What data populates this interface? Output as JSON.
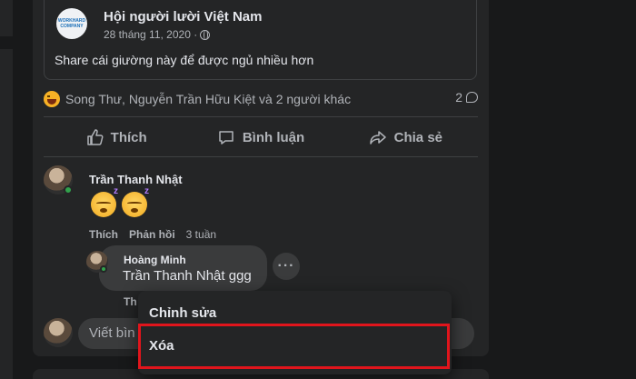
{
  "shared_post": {
    "page_name": "Hội người lười Việt Nam",
    "date": "28 tháng 11, 2020 ·",
    "text": "Share cái giường này để được ngủ nhiều hơn",
    "logo_text": "WORKHARD COMPANY"
  },
  "reactions": {
    "names": "Song Thư, Nguyễn Trần Hữu Kiệt và 2 người khác",
    "comment_count": "2"
  },
  "actions": {
    "like": "Thích",
    "comment": "Bình luận",
    "share": "Chia sẻ"
  },
  "comment": {
    "author": "Trần Thanh Nhật",
    "like_label": "Thích",
    "reply_label": "Phản hồi",
    "time": "3 tuần"
  },
  "reply": {
    "author": "Hoàng Minh",
    "text": "Trần Thanh Nhật ggg",
    "more": "···",
    "under_label": "Th"
  },
  "composer": {
    "placeholder": "Viết bìn"
  },
  "context_menu": {
    "edit": "Chỉnh sửa",
    "delete": "Xóa"
  },
  "colors": {
    "highlight": "#e0151c",
    "online": "#31a24c"
  }
}
